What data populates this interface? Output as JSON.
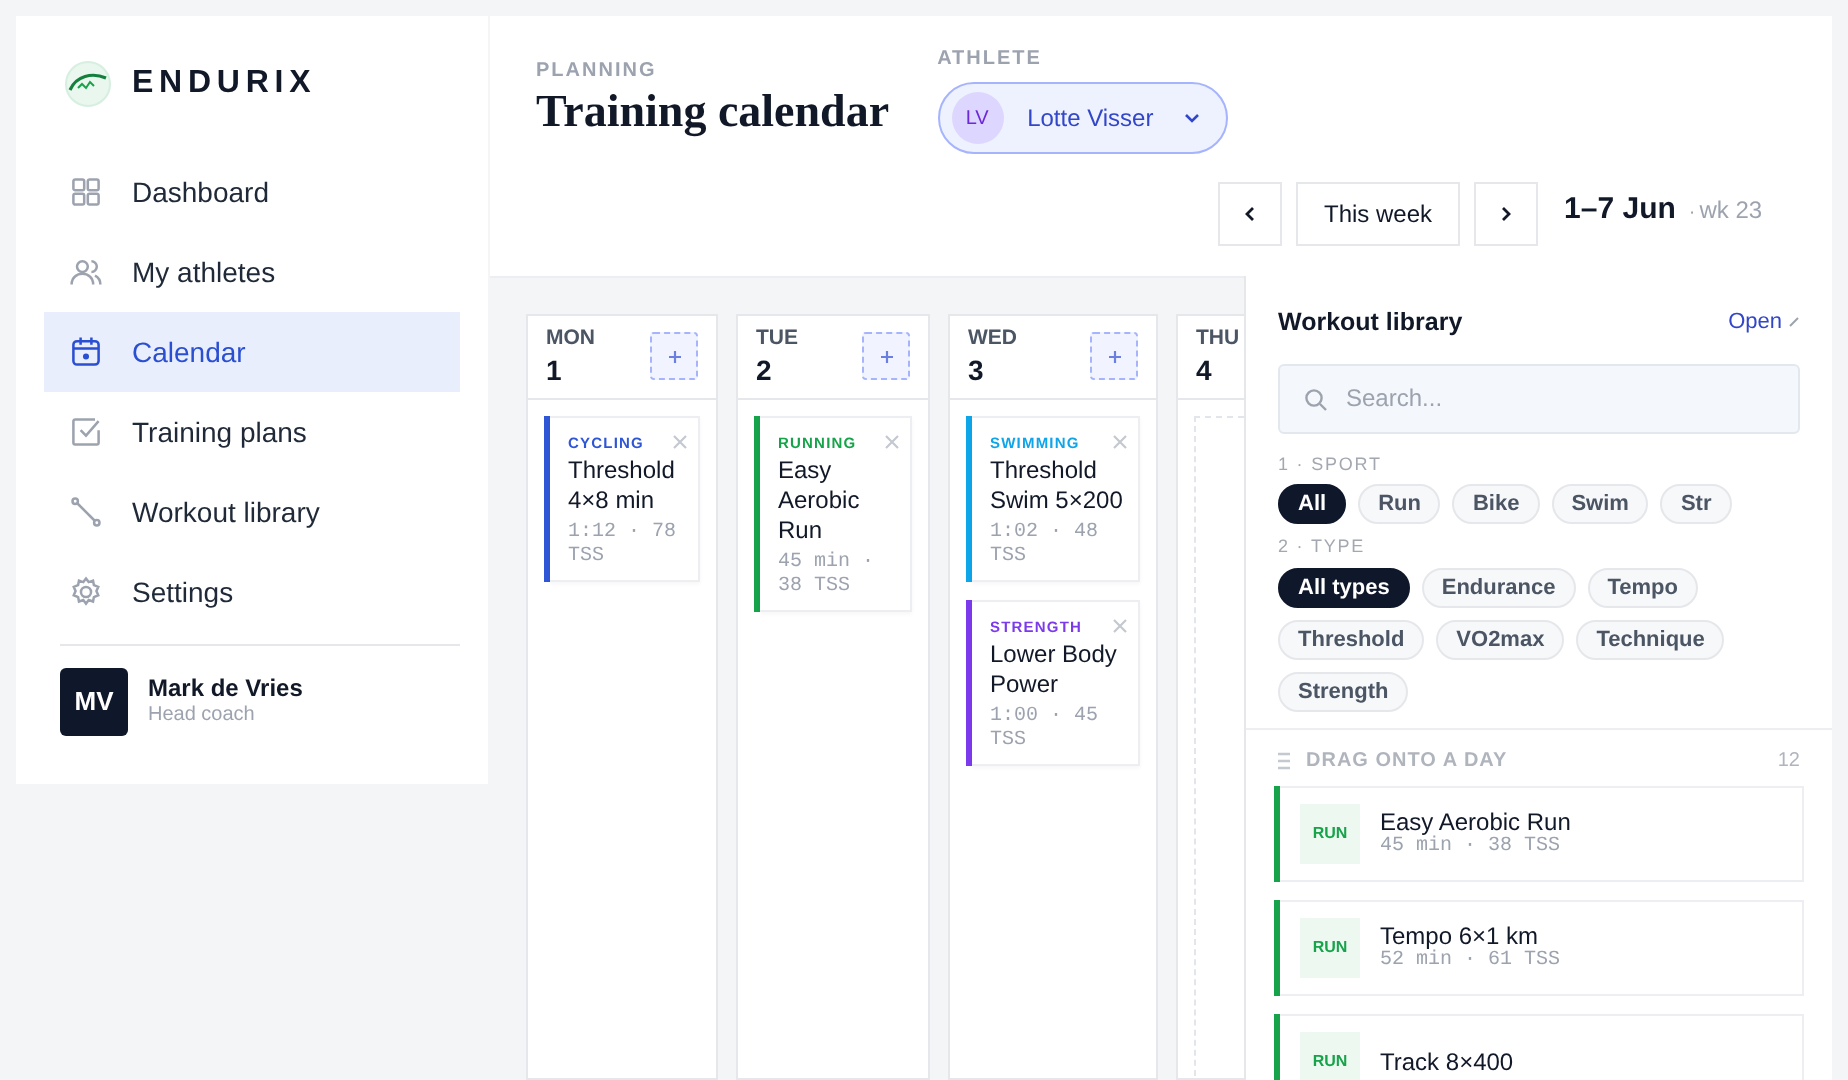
{
  "brand": {
    "name": "ENDURIX"
  },
  "nav": [
    {
      "label": "Dashboard",
      "selected": false
    },
    {
      "label": "My athletes",
      "selected": false
    },
    {
      "label": "Calendar",
      "selected": true
    },
    {
      "label": "Training plans",
      "selected": false
    },
    {
      "label": "Workout library",
      "selected": false
    },
    {
      "label": "Settings",
      "selected": false
    }
  ],
  "user": {
    "initials": "MV",
    "name": "Mark de Vries",
    "role": "Head coach"
  },
  "header": {
    "eyebrow": "PLANNING",
    "title": "Training calendar",
    "athlete_label": "ATHLETE",
    "athlete": {
      "initials": "LV",
      "name": "Lotte Visser"
    }
  },
  "week_nav": {
    "today": "This week",
    "range": "1–7 Jun",
    "separator": "·",
    "week": "wk 23"
  },
  "days": [
    {
      "weekday": "MON",
      "date": "1",
      "workouts": [
        {
          "sport": "CYCLING",
          "color": "#2f56d6",
          "title": "Threshold 4×8 min",
          "meta": "1:12 · 78 TSS"
        }
      ]
    },
    {
      "weekday": "TUE",
      "date": "2",
      "workouts": [
        {
          "sport": "RUNNING",
          "color": "#16a34a",
          "title": "Easy Aerobic Run",
          "meta": "45 min · 38 TSS"
        }
      ]
    },
    {
      "weekday": "WED",
      "date": "3",
      "workouts": [
        {
          "sport": "SWIMMING",
          "color": "#0ea5e9",
          "title": "Threshold Swim 5×200",
          "meta": "1:02 · 48 TSS"
        },
        {
          "sport": "STRENGTH",
          "color": "#7c3aed",
          "title": "Lower Body Power",
          "meta": "1:00 · 45 TSS"
        }
      ]
    },
    {
      "weekday": "THU",
      "date": "4"
    }
  ],
  "library": {
    "title": "Workout library",
    "open_link": "Open",
    "search_placeholder": "Search...",
    "filters": [
      {
        "label": "1 · SPORT",
        "chips": [
          {
            "label": "All",
            "selected": true
          },
          {
            "label": "Run",
            "selected": false
          },
          {
            "label": "Bike",
            "selected": false
          },
          {
            "label": "Swim",
            "selected": false
          },
          {
            "label": "Str",
            "selected": false
          }
        ]
      },
      {
        "label": "2 · TYPE",
        "chips": [
          {
            "label": "All types",
            "selected": true
          },
          {
            "label": "Endurance",
            "selected": false
          },
          {
            "label": "Tempo",
            "selected": false
          },
          {
            "label": "Threshold",
            "selected": false
          },
          {
            "label": "VO2max",
            "selected": false
          },
          {
            "label": "Technique",
            "selected": false
          },
          {
            "label": "Strength",
            "selected": false
          }
        ]
      }
    ],
    "list_header": "DRAG ONTO A DAY",
    "count": "12",
    "items": [
      {
        "badge": "RUN",
        "color": "#16a34a",
        "title": "Easy Aerobic Run",
        "meta": "45 min · 38 TSS"
      },
      {
        "badge": "RUN",
        "color": "#16a34a",
        "title": "Tempo 6×1 km",
        "meta": "52 min · 61 TSS"
      },
      {
        "badge": "RUN",
        "color": "#16a34a",
        "title": "Track 8×400"
      }
    ]
  }
}
